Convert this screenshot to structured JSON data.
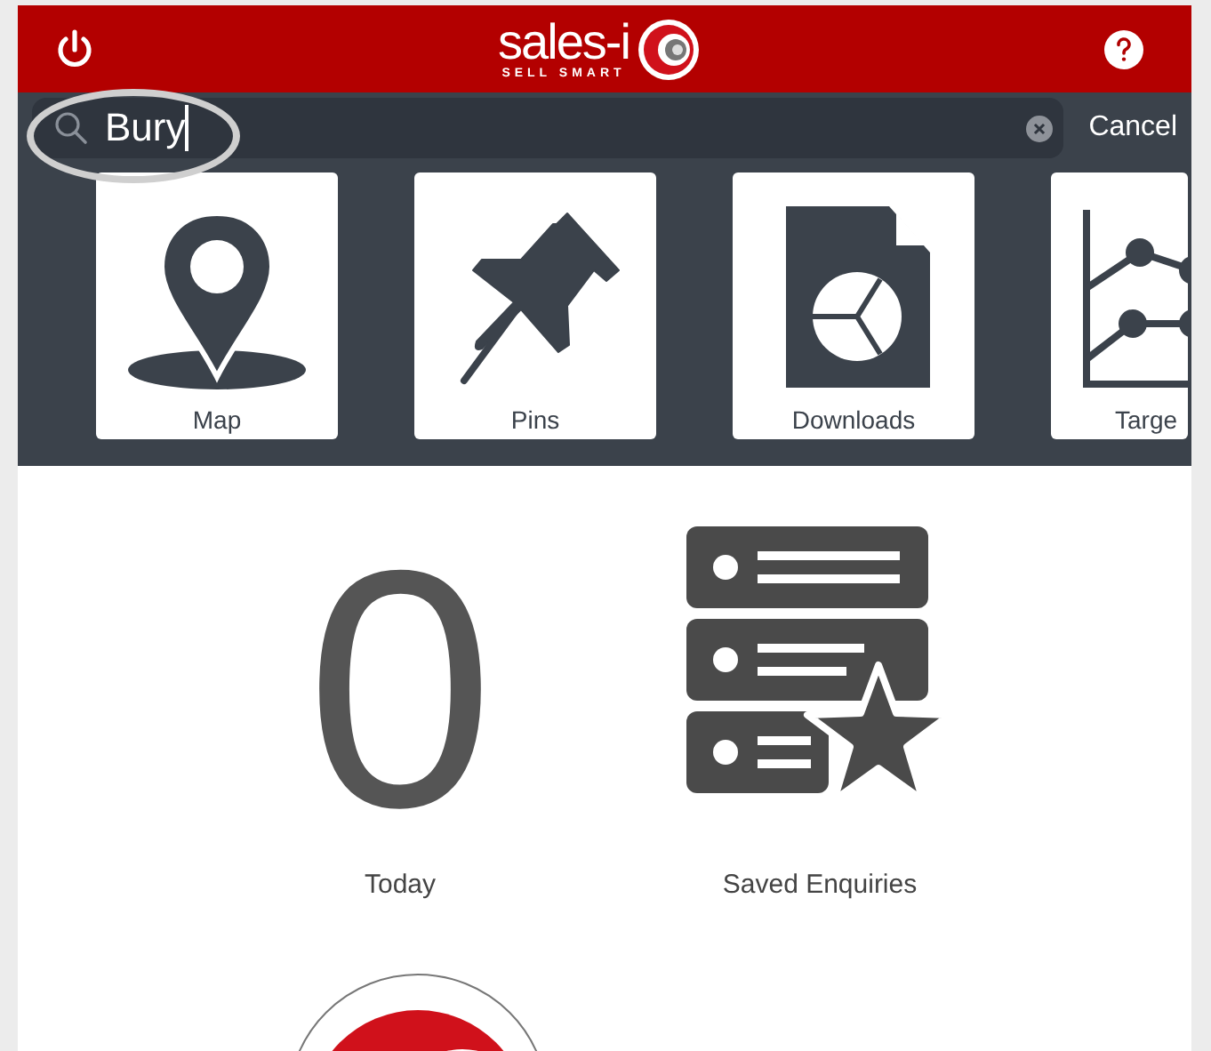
{
  "header": {
    "logo_text": "sales-i",
    "logo_tagline": "SELL SMART"
  },
  "search": {
    "value": "Bury",
    "cancel": "Cancel"
  },
  "tiles": [
    {
      "kind": "map",
      "label": "Map"
    },
    {
      "kind": "pins",
      "label": "Pins"
    },
    {
      "kind": "downloads",
      "label": "Downloads"
    },
    {
      "kind": "chart",
      "label": "Targe"
    }
  ],
  "widgets": [
    {
      "kind": "count",
      "value": "0",
      "label": "Today"
    },
    {
      "kind": "enquiries",
      "label": "Saved Enquiries"
    }
  ]
}
